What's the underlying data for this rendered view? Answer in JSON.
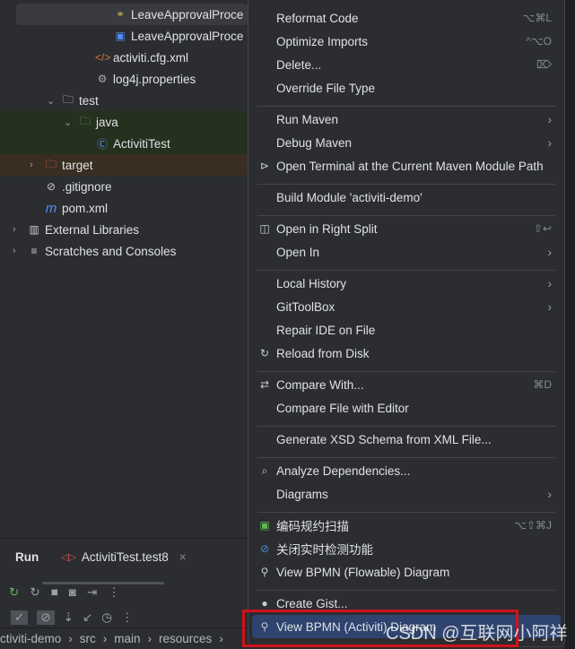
{
  "tree": [
    {
      "label": "LeaveApprovalProce",
      "icon": "bpmn-diagram-icon"
    },
    {
      "label": "LeaveApprovalProce",
      "icon": "image-icon"
    },
    {
      "label": "activiti.cfg.xml",
      "icon": "xml-file-icon"
    },
    {
      "label": "log4j.properties",
      "icon": "gear-icon"
    },
    {
      "label": "test",
      "icon": "folder-icon"
    },
    {
      "label": "java",
      "icon": "folder-icon"
    },
    {
      "label": "ActivitiTest",
      "icon": "class-icon"
    },
    {
      "label": "target",
      "icon": "folder-icon"
    },
    {
      "label": ".gitignore",
      "icon": "ignore-icon"
    },
    {
      "label": "pom.xml",
      "icon": "maven-icon"
    },
    {
      "label": "External Libraries",
      "icon": "library-icon"
    },
    {
      "label": "Scratches and Consoles",
      "icon": "scratches-icon"
    }
  ],
  "run": {
    "title": "Run",
    "tab": "ActivitiTest.test8"
  },
  "breadcrumb": [
    "ctiviti-demo",
    "src",
    "main",
    "resources"
  ],
  "menu": [
    {
      "label": "Reformat Code",
      "shortcut": "⌥⌘L"
    },
    {
      "label": "Optimize Imports",
      "shortcut": "^⌥O"
    },
    {
      "label": "Delete...",
      "shortcut": "⌦"
    },
    {
      "label": "Override File Type"
    },
    {
      "label": "Run Maven",
      "submenu": true
    },
    {
      "label": "Debug Maven",
      "submenu": true
    },
    {
      "label": "Open Terminal at the Current Maven Module Path",
      "icon": "terminal-maven-icon"
    },
    {
      "label": "Build Module 'activiti-demo'"
    },
    {
      "label": "Open in Right Split",
      "icon": "split-icon",
      "shortcut": "⇧↩"
    },
    {
      "label": "Open In",
      "submenu": true
    },
    {
      "label": "Local History",
      "submenu": true
    },
    {
      "label": "GitToolBox",
      "submenu": true
    },
    {
      "label": "Repair IDE on File"
    },
    {
      "label": "Reload from Disk",
      "icon": "reload-icon"
    },
    {
      "label": "Compare With...",
      "icon": "compare-icon",
      "shortcut": "⌘D"
    },
    {
      "label": "Compare File with Editor"
    },
    {
      "label": "Generate XSD Schema from XML File..."
    },
    {
      "label": "Analyze Dependencies...",
      "icon": "analyze-icon"
    },
    {
      "label": "Diagrams",
      "submenu": true
    },
    {
      "label": "编码规约扫描",
      "icon": "scan-icon",
      "shortcut": "⌥⇧⌘J"
    },
    {
      "label": "关闭实时检测功能",
      "icon": "disable-icon"
    },
    {
      "label": "View BPMN (Flowable) Diagram",
      "icon": "bpmn-icon"
    },
    {
      "label": "Create Gist...",
      "icon": "github-icon"
    },
    {
      "label": "View BPMN (Activiti) Diagram",
      "icon": "bpmn-icon",
      "highlighted": true
    }
  ],
  "watermark": "CSDN @互联网小阿祥"
}
